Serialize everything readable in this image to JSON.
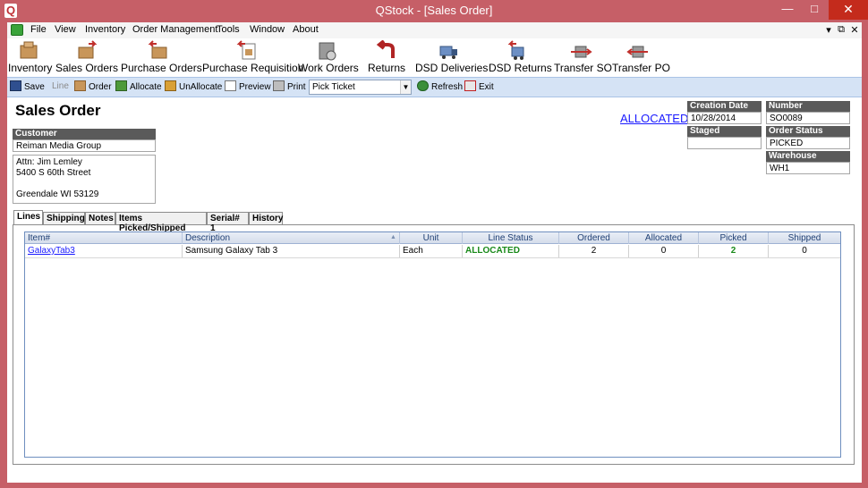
{
  "window": {
    "title": "QStock - [Sales Order]",
    "logo": "Q"
  },
  "menu": [
    "File",
    "View",
    "Inventory",
    "Order Management",
    "Tools",
    "Window",
    "About"
  ],
  "mdi_controls": {
    "minimize": "▾",
    "restore": "⧉",
    "close": "✕"
  },
  "big_toolbar": [
    {
      "label": "Inventory",
      "icon": "boxes-icon"
    },
    {
      "label": "Sales Orders",
      "icon": "sales-orders-icon"
    },
    {
      "label": "Purchase Orders",
      "icon": "purchase-orders-icon"
    },
    {
      "label": "Purchase Requisition",
      "icon": "purchase-requisition-icon"
    },
    {
      "label": "Work Orders",
      "icon": "work-orders-icon"
    },
    {
      "label": "Returns",
      "icon": "returns-icon"
    },
    {
      "label": "DSD Deliveries",
      "icon": "truck-icon"
    },
    {
      "label": "DSD Returns",
      "icon": "truck-return-icon"
    },
    {
      "label": "Transfer SO",
      "icon": "transfer-so-icon"
    },
    {
      "label": "Transfer PO",
      "icon": "transfer-po-icon"
    }
  ],
  "small_toolbar": {
    "save": "Save",
    "line": "Line",
    "order": "Order",
    "allocate": "Allocate",
    "unallocate": "UnAllocate",
    "preview": "Preview",
    "print": "Print",
    "print_format": "Pick Ticket",
    "refresh": "Refresh",
    "exit": "Exit"
  },
  "form": {
    "title": "Sales Order",
    "status_link": "ALLOCATED",
    "customer_label": "Customer",
    "customer_name": "Reiman Media Group",
    "address_lines": [
      "Attn: Jim Lemley",
      "5400 S 60th Street",
      "",
      "Greendale WI 53129"
    ],
    "creation_date_label": "Creation Date",
    "creation_date": "10/28/2014",
    "staged_label": "Staged",
    "staged": "",
    "number_label": "Number",
    "number": "SO0089",
    "order_status_label": "Order Status",
    "order_status": "PICKED",
    "warehouse_label": "Warehouse",
    "warehouse": "WH1"
  },
  "tabs": [
    "Lines",
    "Shipping",
    "Notes",
    "Items Picked/Shipped",
    "Serial# 1",
    "History"
  ],
  "grid": {
    "columns": [
      "Item#",
      "Description",
      "Unit",
      "Line Status",
      "Ordered",
      "Allocated",
      "Picked",
      "Shipped"
    ],
    "rows": [
      {
        "item": "GalaxyTab3",
        "description": "Samsung Galaxy Tab 3",
        "unit": "Each",
        "line_status": "ALLOCATED",
        "ordered": "2",
        "allocated": "0",
        "picked": "2",
        "shipped": "0"
      }
    ]
  },
  "colors": {
    "titlebar": "#c65f67",
    "toolbar_strip": "#d5e3f5",
    "status_green": "#1a8a1a",
    "link_blue": "#1a1aff"
  }
}
